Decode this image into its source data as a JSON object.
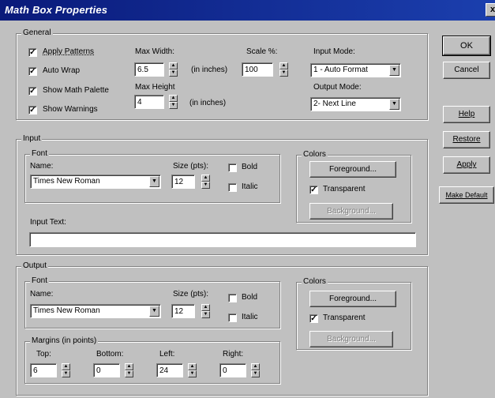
{
  "window": {
    "title": "Math Box Properties",
    "close_glyph": "x"
  },
  "general": {
    "group_label": "General",
    "checkboxes": [
      {
        "label": "Apply Patterns",
        "checked": true
      },
      {
        "label": "Auto Wrap",
        "checked": true
      },
      {
        "label": "Show Math Palette",
        "checked": true
      },
      {
        "label": "Show Warnings",
        "checked": true
      }
    ],
    "check_glyph": "✓",
    "max_width_label": "Max Width:",
    "max_width_value": "6.5",
    "max_width_unit": "(in inches)",
    "max_height_label": "Max Height",
    "max_height_value": "4",
    "max_height_unit": "(in inches)",
    "scale_label": "Scale %:",
    "scale_value": "100",
    "input_mode_label": "Input Mode:",
    "input_mode_value": "1 - Auto Format",
    "output_mode_label": "Output Mode:",
    "output_mode_value": "2- Next Line"
  },
  "input": {
    "group_label": "Input",
    "font_group_label": "Font",
    "name_label": "Name:",
    "font_name": "Times New Roman",
    "size_label": "Size (pts):",
    "size_value": "12",
    "bold_label": "Bold",
    "italic_label": "Italic",
    "colors_label": "Colors",
    "foreground_label": "Foreground...",
    "transparent_label": "Transparent",
    "transparent_checked": true,
    "background_label": "Background...",
    "input_text_label": "Input Text:",
    "input_text_value": ""
  },
  "output": {
    "group_label": "Output",
    "font_group_label": "Font",
    "name_label": "Name:",
    "font_name": "Times New Roman",
    "size_label": "Size (pts):",
    "size_value": "12",
    "bold_label": "Bold",
    "italic_label": "Italic",
    "colors_label": "Colors",
    "foreground_label": "Foreground...",
    "transparent_label": "Transparent",
    "transparent_checked": true,
    "background_label": "Background...",
    "margins_label": "Margins (in points)",
    "top_label": "Top:",
    "top_value": "6",
    "bottom_label": "Bottom:",
    "bottom_value": "0",
    "left_label": "Left:",
    "left_value": "24",
    "right_label": "Right:",
    "right_value": "0"
  },
  "buttons": {
    "ok": "OK",
    "cancel": "Cancel",
    "help": "Help",
    "restore": "Restore",
    "apply": "Apply",
    "make_default": "Make Default"
  },
  "icons": {
    "spin_up": "▲",
    "spin_down": "▼",
    "combo_arrow": "▼"
  }
}
